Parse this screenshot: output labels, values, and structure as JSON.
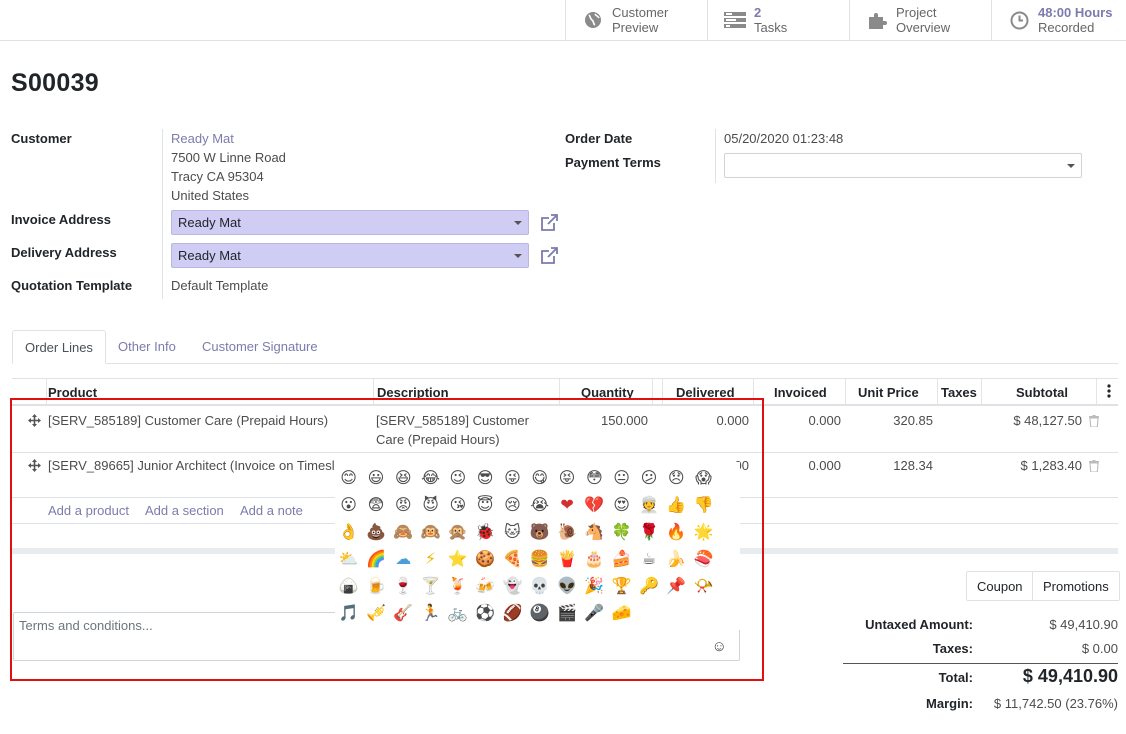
{
  "smart_buttons": [
    {
      "line1": "Customer",
      "line2": "Preview",
      "icon": "globe-icon"
    },
    {
      "value": "2",
      "label": "Tasks",
      "icon": "tasks-icon"
    },
    {
      "line1": "Project",
      "line2": "Overview",
      "icon": "puzzle-icon"
    },
    {
      "value": "48:00 Hours",
      "label": "Recorded",
      "icon": "clock-icon"
    }
  ],
  "record": {
    "name": "S00039"
  },
  "fields": {
    "customer_label": "Customer",
    "customer_name": "Ready Mat",
    "address_line1": "7500 W Linne Road",
    "address_line2": "Tracy CA 95304",
    "address_line3": "United States",
    "invoice_label": "Invoice Address",
    "invoice_value": "Ready Mat",
    "delivery_label": "Delivery Address",
    "delivery_value": "Ready Mat",
    "template_label": "Quotation Template",
    "template_value": "Default Template",
    "order_date_label": "Order Date",
    "order_date_value": "05/20/2020 01:23:48",
    "payment_terms_label": "Payment Terms",
    "payment_terms_value": ""
  },
  "tabs": [
    "Order Lines",
    "Other Info",
    "Customer Signature"
  ],
  "table": {
    "headers": {
      "product": "Product",
      "description": "Description",
      "quantity": "Quantity",
      "delivered": "Delivered",
      "invoiced": "Invoiced",
      "unit_price": "Unit Price",
      "taxes": "Taxes",
      "subtotal": "Subtotal"
    },
    "rows": [
      {
        "product": "[SERV_585189] Customer Care (Prepaid Hours)",
        "desc1": "[SERV_585189] Customer",
        "desc2": "Care (Prepaid Hours)",
        "quantity": "150.000",
        "delivered": "0.000",
        "invoiced": "0.000",
        "unit_price": "320.85",
        "subtotal": "$ 48,127.50"
      },
      {
        "product": "[SERV_89665] Junior Architect (Invoice on Timesl",
        "desc1": "",
        "desc2": "",
        "quantity": "",
        "delivered": "00",
        "invoiced": "0.000",
        "unit_price": "128.34",
        "subtotal": "$ 1,283.40"
      }
    ],
    "add_links": [
      "Add a product",
      "Add a section",
      "Add a note"
    ]
  },
  "note": {
    "placeholder": "Terms and conditions..."
  },
  "emoji_rows": [
    [
      "😊",
      "😃",
      "😆",
      "😂",
      "😉",
      "😎",
      "😜",
      "😋",
      "😝",
      "😳",
      "😐",
      "😕",
      "😞",
      "😱"
    ],
    [
      "😮",
      "😨",
      "😡",
      "😈",
      "😘",
      "😇",
      "😢",
      "😭",
      "❤",
      "💔",
      "😍",
      "👳",
      "👍",
      "👎"
    ],
    [
      "👌",
      "💩",
      "🙈",
      "🙉",
      "🙊",
      "🐞",
      "🐱",
      "🐻",
      "🐌",
      "🐴",
      "🍀",
      "🌹",
      "🔥",
      "🌟"
    ],
    [
      "⛅",
      "🌈",
      "☁",
      "⚡",
      "⭐",
      "🍪",
      "🍕",
      "🍔",
      "🍟",
      "🎂",
      "🍰",
      "☕",
      "🍌",
      "🍣"
    ],
    [
      "🍙",
      "🍺",
      "🍷",
      "🍸",
      "🍹",
      "🍻",
      "👻",
      "💀",
      "👽",
      "🎉",
      "🏆",
      "🔑",
      "📌",
      "📯"
    ],
    [
      "🎵",
      "🎺",
      "🎸",
      "🏃",
      "🚲",
      "⚽",
      "🏈",
      "🎱",
      "🎬",
      "🎤",
      "🧀"
    ]
  ],
  "actions": {
    "coupon": "Coupon",
    "promotions": "Promotions"
  },
  "totals": {
    "untaxed_label": "Untaxed Amount:",
    "untaxed_value": "$ 49,410.90",
    "taxes_label": "Taxes:",
    "taxes_value": "$ 0.00",
    "total_label": "Total:",
    "total_value": "$ 49,410.90",
    "margin_label": "Margin:",
    "margin_value": "$ 11,742.50 (23.76%)"
  },
  "colors": {
    "accent": "#7c7bad",
    "many2one_bg": "#cfcdf3",
    "highlight": "#e01010"
  }
}
